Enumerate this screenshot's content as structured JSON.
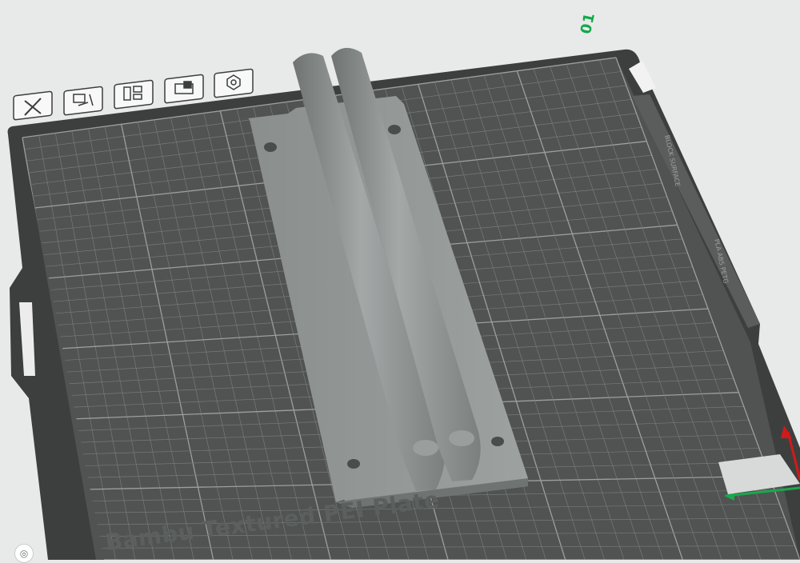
{
  "plate": {
    "number": "01",
    "name": "Bambu Textured PEI Plate",
    "side_label_top": "BLOCK SURFACE",
    "side_label_materials": "PLA ABS PETG"
  },
  "toolbar": {
    "buttons": [
      {
        "name": "delete-plate-button",
        "icon": "close-icon"
      },
      {
        "name": "auto-orient-button",
        "icon": "orient-icon"
      },
      {
        "name": "arrange-button",
        "icon": "arrange-icon"
      },
      {
        "name": "lock-button",
        "icon": "lock-icon"
      },
      {
        "name": "plate-settings-button",
        "icon": "gear-hex-icon"
      }
    ]
  },
  "axes": {
    "x_color": "#1aa84a",
    "y_color": "#d11a1a"
  },
  "colors": {
    "bed": "#4e5150",
    "grid": "#8c9190",
    "model": "#8f9392",
    "accent": "#12a84a"
  }
}
